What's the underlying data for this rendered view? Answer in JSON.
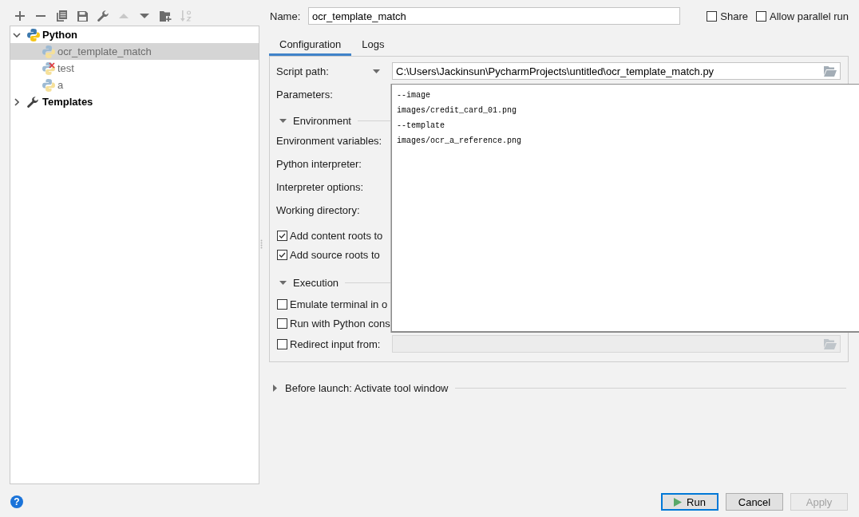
{
  "toolbar": [
    {
      "kind": "add",
      "disabled": false
    },
    {
      "kind": "remove",
      "disabled": false
    },
    {
      "kind": "copy",
      "disabled": false
    },
    {
      "kind": "save",
      "disabled": false
    },
    {
      "kind": "wrench",
      "disabled": false
    },
    {
      "kind": "move_up",
      "disabled": true
    },
    {
      "kind": "move_down",
      "disabled": false
    },
    {
      "kind": "new_folder",
      "disabled": false
    },
    {
      "kind": "sort",
      "disabled": true
    }
  ],
  "tree": [
    {
      "label": "Python",
      "kind": "python",
      "expanded": true,
      "selected": false,
      "children": [
        {
          "label": "ocr_template_match",
          "selected": true,
          "error": false
        },
        {
          "label": "test",
          "selected": false,
          "error": true
        },
        {
          "label": "a",
          "selected": false,
          "error": false
        }
      ]
    },
    {
      "label": "Templates",
      "kind": "templates",
      "expanded": false,
      "selected": false
    }
  ],
  "help_button": {
    "label": "?"
  },
  "name_field": {
    "label": "Name:",
    "value": "ocr_template_match"
  },
  "options": [
    {
      "label": "Share",
      "checked": false
    },
    {
      "label": "Allow parallel run",
      "checked": false
    }
  ],
  "tabs": [
    {
      "label": "Configuration",
      "selected": true
    },
    {
      "label": "Logs",
      "selected": false
    }
  ],
  "configuration": {
    "rows": [
      {
        "kind": "path",
        "label": "Script path:",
        "value": "C:\\Users\\Jackinsun\\PycharmProjects\\untitled\\ocr_template_match.py"
      },
      {
        "kind": "label",
        "label": "Parameters:"
      },
      {
        "kind": "section",
        "label": "Environment",
        "expanded": true
      },
      {
        "kind": "label",
        "label": "Environment variables:"
      },
      {
        "kind": "label",
        "label": "Python interpreter:"
      },
      {
        "kind": "label",
        "label": "Interpreter options:"
      },
      {
        "kind": "label",
        "label": "Working directory:"
      },
      {
        "kind": "checkbox",
        "label": "Add content roots to",
        "checked": true
      },
      {
        "kind": "checkbox",
        "label": "Add source roots to",
        "checked": true
      },
      {
        "kind": "section",
        "label": "Execution",
        "expanded": true
      },
      {
        "kind": "checkbox",
        "label": "Emulate terminal in o",
        "checked": false
      },
      {
        "kind": "checkbox",
        "label": "Run with Python cons",
        "checked": false
      },
      {
        "kind": "checkbox_path",
        "label": "Redirect input from:",
        "checked": false,
        "disabled": true
      }
    ],
    "parameters_popup": {
      "lines": [
        "--image",
        "images/credit_card_01.png",
        "--template",
        "images/ocr_a_reference.png"
      ]
    }
  },
  "before_launch": {
    "label": "Before launch: Activate tool window",
    "expanded": false
  },
  "buttons": [
    {
      "label": "Run",
      "kind": "run",
      "focused": true,
      "disabled": false
    },
    {
      "label": "Cancel",
      "kind": "plain",
      "focused": false,
      "disabled": false
    },
    {
      "label": "Apply",
      "kind": "plain",
      "focused": false,
      "disabled": true
    }
  ]
}
